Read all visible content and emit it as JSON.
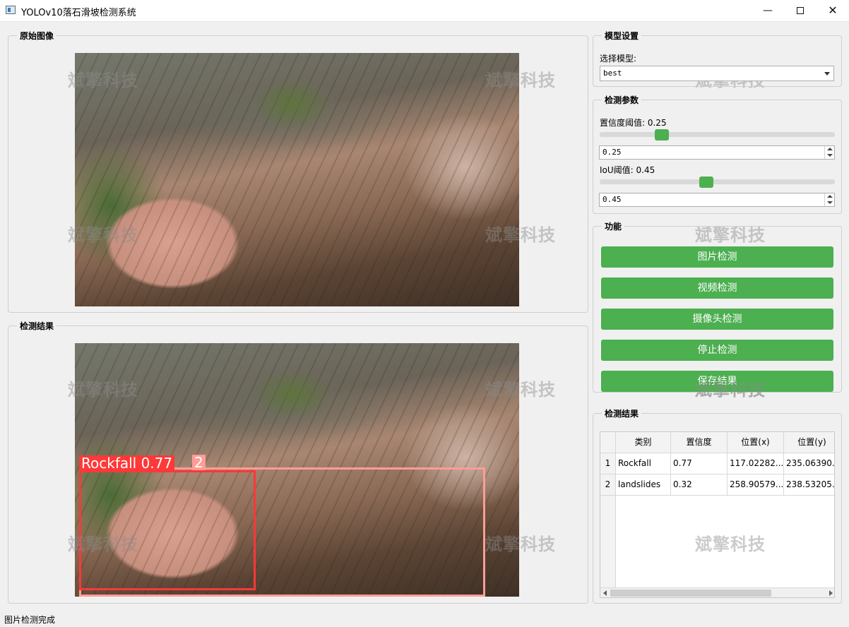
{
  "window": {
    "title": "YOLOv10落石滑坡检测系统",
    "minimize": "—",
    "close": "✕"
  },
  "panels": {
    "original": "原始图像",
    "result": "检测结果"
  },
  "watermark": "斌擎科技",
  "model": {
    "group": "模型设置",
    "label": "选择模型:",
    "value": "best"
  },
  "params": {
    "group": "检测参数",
    "conf_label": "置信度阈值: 0.25",
    "conf_value": "0.25",
    "conf_level": 0.25,
    "iou_label": "IoU阈值: 0.45",
    "iou_value": "0.45",
    "iou_level": 0.45
  },
  "functions": {
    "group": "功能",
    "buttons": [
      "图片检测",
      "视频检测",
      "摄像头检测",
      "停止检测",
      "保存结果"
    ]
  },
  "detections": {
    "boxes": [
      {
        "label": "Rockfall 0.77",
        "color": "#ff3838"
      },
      {
        "label": "2",
        "color": "#ff9d97"
      }
    ]
  },
  "results": {
    "group": "检测结果",
    "headers": [
      "类别",
      "置信度",
      "位置(x)",
      "位置(y)"
    ],
    "rows": [
      {
        "index": "1",
        "cls": "Rockfall",
        "conf": "0.77",
        "x": "117.02282...",
        "y": "235.06390..."
      },
      {
        "index": "2",
        "cls": "landslides",
        "conf": "0.32",
        "x": "258.90579...",
        "y": "238.53205..."
      }
    ]
  },
  "status": "图片检测完成",
  "colors": {
    "accent": "#4caf50",
    "rockfall_box": "#ff3838",
    "landslide_box": "#ff9d97"
  }
}
